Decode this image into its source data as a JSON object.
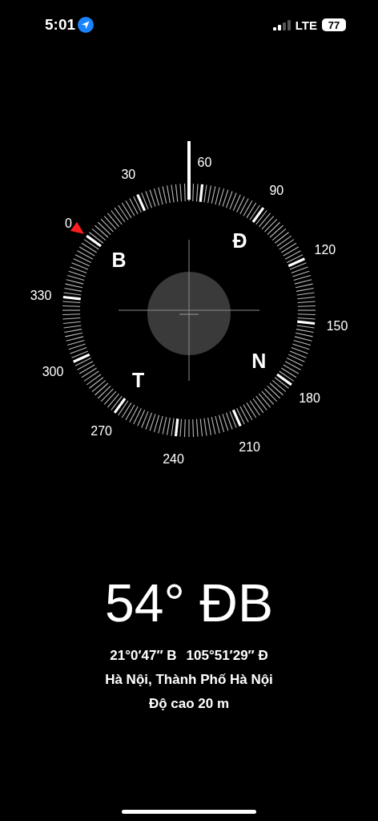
{
  "status_bar": {
    "time": "5:01",
    "network": "LTE",
    "battery": "77"
  },
  "compass": {
    "degree_labels": [
      "0",
      "30",
      "60",
      "90",
      "120",
      "150",
      "180",
      "210",
      "240",
      "270",
      "300",
      "330"
    ],
    "cardinals": [
      "B",
      "Đ",
      "N",
      "T"
    ]
  },
  "heading": "54° ĐB",
  "coordinates": [
    "21°0′47″ B",
    "105°51′29″ Đ"
  ],
  "place": "Hà Nội, Thành Phố Hà Nội",
  "altitude": "Độ cao 20 m"
}
